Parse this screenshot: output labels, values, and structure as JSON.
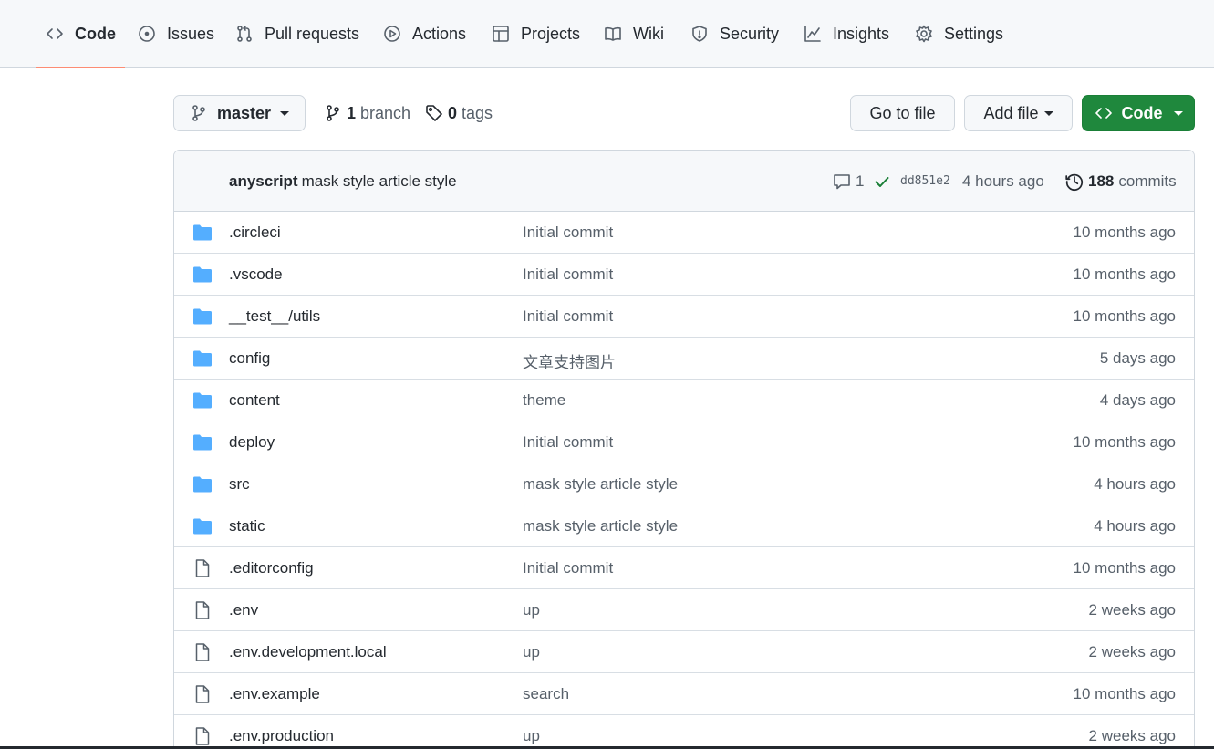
{
  "nav": {
    "tabs": [
      {
        "label": "Code",
        "icon": "code-icon",
        "active": true
      },
      {
        "label": "Issues",
        "icon": "issue-icon"
      },
      {
        "label": "Pull requests",
        "icon": "pull-request-icon"
      },
      {
        "label": "Actions",
        "icon": "play-icon"
      },
      {
        "label": "Projects",
        "icon": "table-icon"
      },
      {
        "label": "Wiki",
        "icon": "book-icon"
      },
      {
        "label": "Security",
        "icon": "shield-icon"
      },
      {
        "label": "Insights",
        "icon": "graph-icon"
      },
      {
        "label": "Settings",
        "icon": "gear-icon"
      }
    ]
  },
  "toolbar": {
    "branch": "master",
    "branch_count": "1",
    "branch_label": "branch",
    "tag_count": "0",
    "tag_label": "tags",
    "go_to_file": "Go to file",
    "add_file": "Add file",
    "code": "Code"
  },
  "commit": {
    "author": "anyscript",
    "message": "mask style article style",
    "comments": "1",
    "sha": "dd851e2",
    "time": "4 hours ago",
    "commit_count": "188",
    "commit_label": "commits"
  },
  "colors": {
    "accent_tab": "#fd8c73",
    "green_button": "#1f883d",
    "folder": "#54aeff",
    "check": "#1a7f37"
  },
  "files": [
    {
      "type": "folder",
      "name": ".circleci",
      "message": "Initial commit",
      "age": "10 months ago"
    },
    {
      "type": "folder",
      "name": ".vscode",
      "message": "Initial commit",
      "age": "10 months ago"
    },
    {
      "type": "folder",
      "name": "__test__/utils",
      "message": "Initial commit",
      "age": "10 months ago"
    },
    {
      "type": "folder",
      "name": "config",
      "message": "文章支持图片",
      "age": "5 days ago"
    },
    {
      "type": "folder",
      "name": "content",
      "message": "theme",
      "age": "4 days ago"
    },
    {
      "type": "folder",
      "name": "deploy",
      "message": "Initial commit",
      "age": "10 months ago"
    },
    {
      "type": "folder",
      "name": "src",
      "message": "mask style article style",
      "age": "4 hours ago"
    },
    {
      "type": "folder",
      "name": "static",
      "message": "mask style article style",
      "age": "4 hours ago"
    },
    {
      "type": "file",
      "name": ".editorconfig",
      "message": "Initial commit",
      "age": "10 months ago"
    },
    {
      "type": "file",
      "name": ".env",
      "message": "up",
      "age": "2 weeks ago"
    },
    {
      "type": "file",
      "name": ".env.development.local",
      "message": "up",
      "age": "2 weeks ago"
    },
    {
      "type": "file",
      "name": ".env.example",
      "message": "search",
      "age": "10 months ago"
    },
    {
      "type": "file",
      "name": ".env.production",
      "message": "up",
      "age": "2 weeks ago"
    }
  ]
}
